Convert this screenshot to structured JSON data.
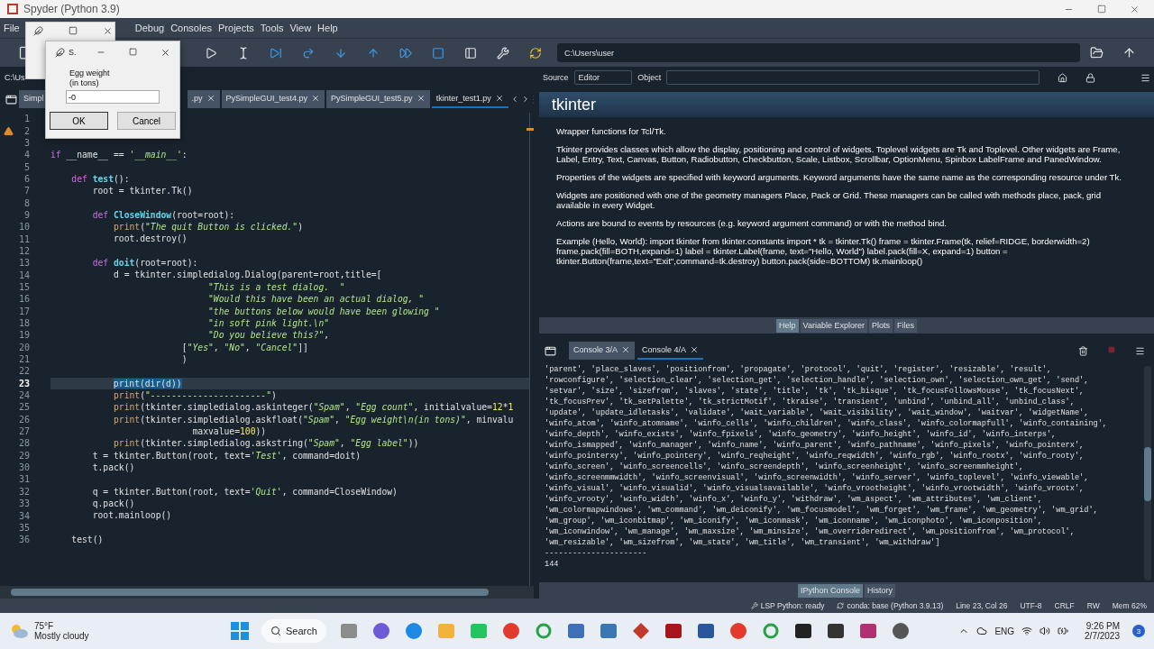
{
  "window": {
    "title": "Spyder (Python 3.9)"
  },
  "menu": [
    "File",
    "Debug",
    "Consoles",
    "Projects",
    "Tools",
    "View",
    "Help"
  ],
  "toolbar": {
    "path": "C:\\Users\\user"
  },
  "editor": {
    "path": "C:\\Us",
    "tabs": [
      {
        "label": "Simpl",
        "selected": false
      },
      {
        "label": ".py",
        "selected": false
      },
      {
        "label": "PySimpleGUI_test4.py",
        "selected": false
      },
      {
        "label": "PySimpleGUI_test5.py",
        "selected": false
      },
      {
        "label": "tkinter_test1.py",
        "selected": true
      }
    ],
    "lines": [
      {
        "number": "1",
        "current": false,
        "warning": false
      },
      {
        "number": "2",
        "current": false,
        "warning": true
      },
      {
        "number": "3",
        "current": false,
        "warning": false
      },
      {
        "number": "4",
        "current": false,
        "warning": false,
        "segments": [
          {
            "kind": "kw",
            "text": "if"
          },
          {
            "kind": "plain",
            "text": " __name__ == "
          },
          {
            "kind": "str",
            "text": "'__main__'"
          },
          {
            "kind": "plain",
            "text": ":"
          }
        ]
      },
      {
        "number": "5",
        "current": false,
        "warning": false
      },
      {
        "number": "6",
        "current": false,
        "warning": false,
        "segments": [
          {
            "kind": "kw",
            "text": "    def"
          },
          {
            "kind": "fn",
            "text": " test"
          },
          {
            "kind": "plain",
            "text": "():"
          }
        ]
      },
      {
        "number": "7",
        "current": false,
        "warning": false,
        "segments": [
          {
            "kind": "plain",
            "text": "        root = tkinter.Tk()"
          }
        ]
      },
      {
        "number": "8",
        "current": false,
        "warning": false
      },
      {
        "number": "9",
        "current": false,
        "warning": false,
        "segments": [
          {
            "kind": "kw",
            "text": "        def"
          },
          {
            "kind": "fn",
            "text": " CloseWindow"
          },
          {
            "kind": "plain",
            "text": "(root=root):"
          }
        ]
      },
      {
        "number": "10",
        "current": false,
        "warning": false,
        "segments": [
          {
            "kind": "builtin",
            "text": "            print"
          },
          {
            "kind": "plain",
            "text": "("
          },
          {
            "kind": "str",
            "text": "\"The quit Button is clicked.\""
          },
          {
            "kind": "plain",
            "text": ")"
          }
        ]
      },
      {
        "number": "11",
        "current": false,
        "warning": false,
        "segments": [
          {
            "kind": "plain",
            "text": "            root.destroy()"
          }
        ]
      },
      {
        "number": "12",
        "current": false,
        "warning": false
      },
      {
        "number": "13",
        "current": false,
        "warning": false,
        "segments": [
          {
            "kind": "kw",
            "text": "        def"
          },
          {
            "kind": "fn",
            "text": " doit"
          },
          {
            "kind": "plain",
            "text": "(root=root):"
          }
        ]
      },
      {
        "number": "14",
        "current": false,
        "warning": false,
        "segments": [
          {
            "kind": "plain",
            "text": "            d = tkinter.simpledialog.Dialog(parent=root,title=["
          }
        ]
      },
      {
        "number": "15",
        "current": false,
        "warning": false,
        "segments": [
          {
            "kind": "str",
            "text": "                              \"This is a test dialog.  \""
          }
        ]
      },
      {
        "number": "16",
        "current": false,
        "warning": false,
        "segments": [
          {
            "kind": "str",
            "text": "                              \"Would this have been an actual dialog, \""
          }
        ]
      },
      {
        "number": "17",
        "current": false,
        "warning": false,
        "segments": [
          {
            "kind": "str",
            "text": "                              \"the buttons below would have been glowing \""
          }
        ]
      },
      {
        "number": "18",
        "current": false,
        "warning": false,
        "segments": [
          {
            "kind": "str",
            "text": "                              \"in soft pink light.\\n\""
          }
        ]
      },
      {
        "number": "19",
        "current": false,
        "warning": false,
        "segments": [
          {
            "kind": "str",
            "text": "                              \"Do you believe this?\""
          },
          {
            "kind": "plain",
            "text": ","
          }
        ]
      },
      {
        "number": "20",
        "current": false,
        "warning": false,
        "segments": [
          {
            "kind": "plain",
            "text": "                         ["
          },
          {
            "kind": "str",
            "text": "\"Yes\""
          },
          {
            "kind": "plain",
            "text": ", "
          },
          {
            "kind": "str",
            "text": "\"No\""
          },
          {
            "kind": "plain",
            "text": ", "
          },
          {
            "kind": "str",
            "text": "\"Cancel\""
          },
          {
            "kind": "plain",
            "text": "]]"
          }
        ]
      },
      {
        "number": "21",
        "current": false,
        "warning": false,
        "segments": [
          {
            "kind": "plain",
            "text": "                         )"
          }
        ]
      },
      {
        "number": "22",
        "current": false,
        "warning": false
      },
      {
        "number": "23",
        "current": true,
        "warning": false,
        "segments": [
          {
            "kind": "selected",
            "text": "print(dir(d))"
          }
        ]
      },
      {
        "number": "24",
        "current": false,
        "warning": false,
        "segments": [
          {
            "kind": "builtin",
            "text": "            print"
          },
          {
            "kind": "plain",
            "text": "("
          },
          {
            "kind": "str",
            "text": "\"----------------------\""
          },
          {
            "kind": "plain",
            "text": ")"
          }
        ]
      },
      {
        "number": "25",
        "current": false,
        "warning": false,
        "segments": [
          {
            "kind": "builtin",
            "text": "            print"
          },
          {
            "kind": "plain",
            "text": "(tkinter.simpledialog.askinteger("
          },
          {
            "kind": "str",
            "text": "\"Spam\""
          },
          {
            "kind": "plain",
            "text": ", "
          },
          {
            "kind": "str",
            "text": "\"Egg count\""
          },
          {
            "kind": "plain",
            "text": ", initialvalue="
          },
          {
            "kind": "num",
            "text": "12"
          },
          {
            "kind": "plain",
            "text": "*"
          },
          {
            "kind": "num",
            "text": "1"
          }
        ]
      },
      {
        "number": "26",
        "current": false,
        "warning": false,
        "segments": [
          {
            "kind": "builtin",
            "text": "            print"
          },
          {
            "kind": "plain",
            "text": "(tkinter.simpledialog.askfloat("
          },
          {
            "kind": "str",
            "text": "\"Spam\""
          },
          {
            "kind": "plain",
            "text": ", "
          },
          {
            "kind": "str",
            "text": "\"Egg weight\\n(in tons)\""
          },
          {
            "kind": "plain",
            "text": ", minvalu"
          }
        ]
      },
      {
        "number": "27",
        "current": false,
        "warning": false,
        "segments": [
          {
            "kind": "plain",
            "text": "                           maxvalue="
          },
          {
            "kind": "num",
            "text": "100"
          },
          {
            "kind": "plain",
            "text": "))"
          }
        ]
      },
      {
        "number": "28",
        "current": false,
        "warning": false,
        "segments": [
          {
            "kind": "builtin",
            "text": "            print"
          },
          {
            "kind": "plain",
            "text": "(tkinter.simpledialog.askstring("
          },
          {
            "kind": "str",
            "text": "\"Spam\""
          },
          {
            "kind": "plain",
            "text": ", "
          },
          {
            "kind": "str",
            "text": "\"Egg label\""
          },
          {
            "kind": "plain",
            "text": "))"
          }
        ]
      },
      {
        "number": "29",
        "current": false,
        "warning": false,
        "segments": [
          {
            "kind": "plain",
            "text": "        t = tkinter.Button(root, text="
          },
          {
            "kind": "str",
            "text": "'Test'"
          },
          {
            "kind": "plain",
            "text": ", command=doit)"
          }
        ]
      },
      {
        "number": "30",
        "current": false,
        "warning": false,
        "segments": [
          {
            "kind": "plain",
            "text": "        t.pack()"
          }
        ]
      },
      {
        "number": "31",
        "current": false,
        "warning": false
      },
      {
        "number": "32",
        "current": false,
        "warning": false,
        "segments": [
          {
            "kind": "plain",
            "text": "        q = tkinter.Button(root, text="
          },
          {
            "kind": "str",
            "text": "'Quit'"
          },
          {
            "kind": "plain",
            "text": ", command=CloseWindow)"
          }
        ]
      },
      {
        "number": "33",
        "current": false,
        "warning": false,
        "segments": [
          {
            "kind": "plain",
            "text": "        q.pack()"
          }
        ]
      },
      {
        "number": "34",
        "current": false,
        "warning": false,
        "segments": [
          {
            "kind": "plain",
            "text": "        root.mainloop()"
          }
        ]
      },
      {
        "number": "35",
        "current": false,
        "warning": false
      },
      {
        "number": "36",
        "current": false,
        "warning": false,
        "segments": [
          {
            "kind": "plain",
            "text": "    test()"
          }
        ]
      }
    ]
  },
  "dialog": {
    "title": "S.",
    "label": "Egg weight\n(in tons)",
    "value": "-0",
    "buttons": [
      "OK",
      "Cancel"
    ]
  },
  "help": {
    "source_label": "Source",
    "source": "Editor",
    "object_label": "Object",
    "title": "tkinter",
    "paragraphs": [
      "Wrapper functions for Tcl/Tk.",
      "Tkinter provides classes which allow the display, positioning and control of widgets. Toplevel widgets are Tk and Toplevel. Other widgets are Frame, Label, Entry, Text, Canvas, Button, Radiobutton, Checkbutton, Scale, Listbox, Scrollbar, OptionMenu, Spinbox LabelFrame and PanedWindow.",
      "Properties of the widgets are specified with keyword arguments. Keyword arguments have the same name as the corresponding resource under Tk.",
      "Widgets are positioned with one of the geometry managers Place, Pack or Grid. These managers can be called with methods place, pack, grid available in every Widget.",
      "Actions are bound to events by resources (e.g. keyword argument command) or with the method bind.",
      "Example (Hello, World): import tkinter from tkinter.constants import * tk = tkinter.Tk() frame = tkinter.Frame(tk, relief=RIDGE, borderwidth=2) frame.pack(fill=BOTH,expand=1) label = tkinter.Label(frame, text=\"Hello, World\") label.pack(fill=X, expand=1) button = tkinter.Button(frame,text=\"Exit\",command=tk.destroy) button.pack(side=BOTTOM) tk.mainloop()"
    ],
    "tabs": [
      {
        "label": "Help",
        "selected": true
      },
      {
        "label": "Variable Explorer",
        "selected": false
      },
      {
        "label": "Plots",
        "selected": false
      },
      {
        "label": "Files",
        "selected": false
      }
    ]
  },
  "console": {
    "tabs": [
      {
        "label": "Console 3/A",
        "selected": false
      },
      {
        "label": "Console 4/A",
        "selected": true
      }
    ],
    "output": [
      "'parent', 'place_slaves', 'positionfrom', 'propagate', 'protocol', 'quit', 'register', 'resizable', 'result',",
      "'rowconfigure', 'selection_clear', 'selection_get', 'selection_handle', 'selection_own', 'selection_own_get', 'send',",
      "'setvar', 'size', 'sizefrom', 'slaves', 'state', 'title', 'tk', 'tk_bisque', 'tk_focusFollowsMouse', 'tk_focusNext',",
      "'tk_focusPrev', 'tk_setPalette', 'tk_strictMotif', 'tkraise', 'transient', 'unbind', 'unbind_all', 'unbind_class',",
      "'update', 'update_idletasks', 'validate', 'wait_variable', 'wait_visibility', 'wait_window', 'waitvar', 'widgetName',",
      "'winfo_atom', 'winfo_atomname', 'winfo_cells', 'winfo_children', 'winfo_class', 'winfo_colormapfull', 'winfo_containing',",
      "'winfo_depth', 'winfo_exists', 'winfo_fpixels', 'winfo_geometry', 'winfo_height', 'winfo_id', 'winfo_interps',",
      "'winfo_ismapped', 'winfo_manager', 'winfo_name', 'winfo_parent', 'winfo_pathname', 'winfo_pixels', 'winfo_pointerx',",
      "'winfo_pointerxy', 'winfo_pointery', 'winfo_reqheight', 'winfo_reqwidth', 'winfo_rgb', 'winfo_rootx', 'winfo_rooty',",
      "'winfo_screen', 'winfo_screencells', 'winfo_screendepth', 'winfo_screenheight', 'winfo_screenmmheight',",
      "'winfo_screenmmwidth', 'winfo_screenvisual', 'winfo_screenwidth', 'winfo_server', 'winfo_toplevel', 'winfo_viewable',",
      "'winfo_visual', 'winfo_visualid', 'winfo_visualsavailable', 'winfo_vrootheight', 'winfo_vrootwidth', 'winfo_vrootx',",
      "'winfo_vrooty', 'winfo_width', 'winfo_x', 'winfo_y', 'withdraw', 'wm_aspect', 'wm_attributes', 'wm_client',",
      "'wm_colormapwindows', 'wm_command', 'wm_deiconify', 'wm_focusmodel', 'wm_forget', 'wm_frame', 'wm_geometry', 'wm_grid',",
      "'wm_group', 'wm_iconbitmap', 'wm_iconify', 'wm_iconmask', 'wm_iconname', 'wm_iconphoto', 'wm_iconposition',",
      "'wm_iconwindow', 'wm_manage', 'wm_maxsize', 'wm_minsize', 'wm_overrideredirect', 'wm_positionfrom', 'wm_protocol',",
      "'wm_resizable', 'wm_sizefrom', 'wm_state', 'wm_title', 'wm_transient', 'wm_withdraw']",
      "----------------------",
      "144"
    ],
    "bottom_tabs": [
      {
        "label": "IPython Console",
        "selected": true
      },
      {
        "label": "History",
        "selected": false
      }
    ]
  },
  "status_bar": [
    {
      "kind": "lsp",
      "text": "LSP Python: ready"
    },
    {
      "kind": "conda",
      "text": "conda: base (Python 3.9.13)"
    },
    {
      "kind": "plain",
      "text": "Line 23, Col 26"
    },
    {
      "kind": "plain",
      "text": "UTF-8"
    },
    {
      "kind": "plain",
      "text": "CRLF"
    },
    {
      "kind": "plain",
      "text": "RW"
    },
    {
      "kind": "plain",
      "text": "Mem 62%"
    }
  ],
  "taskbar": {
    "temperature": "75°F",
    "weather": "Mostly cloudy",
    "search": "Search",
    "language": "ENG",
    "time": "9:26 PM",
    "date": "2/7/2023",
    "badge": "3"
  }
}
